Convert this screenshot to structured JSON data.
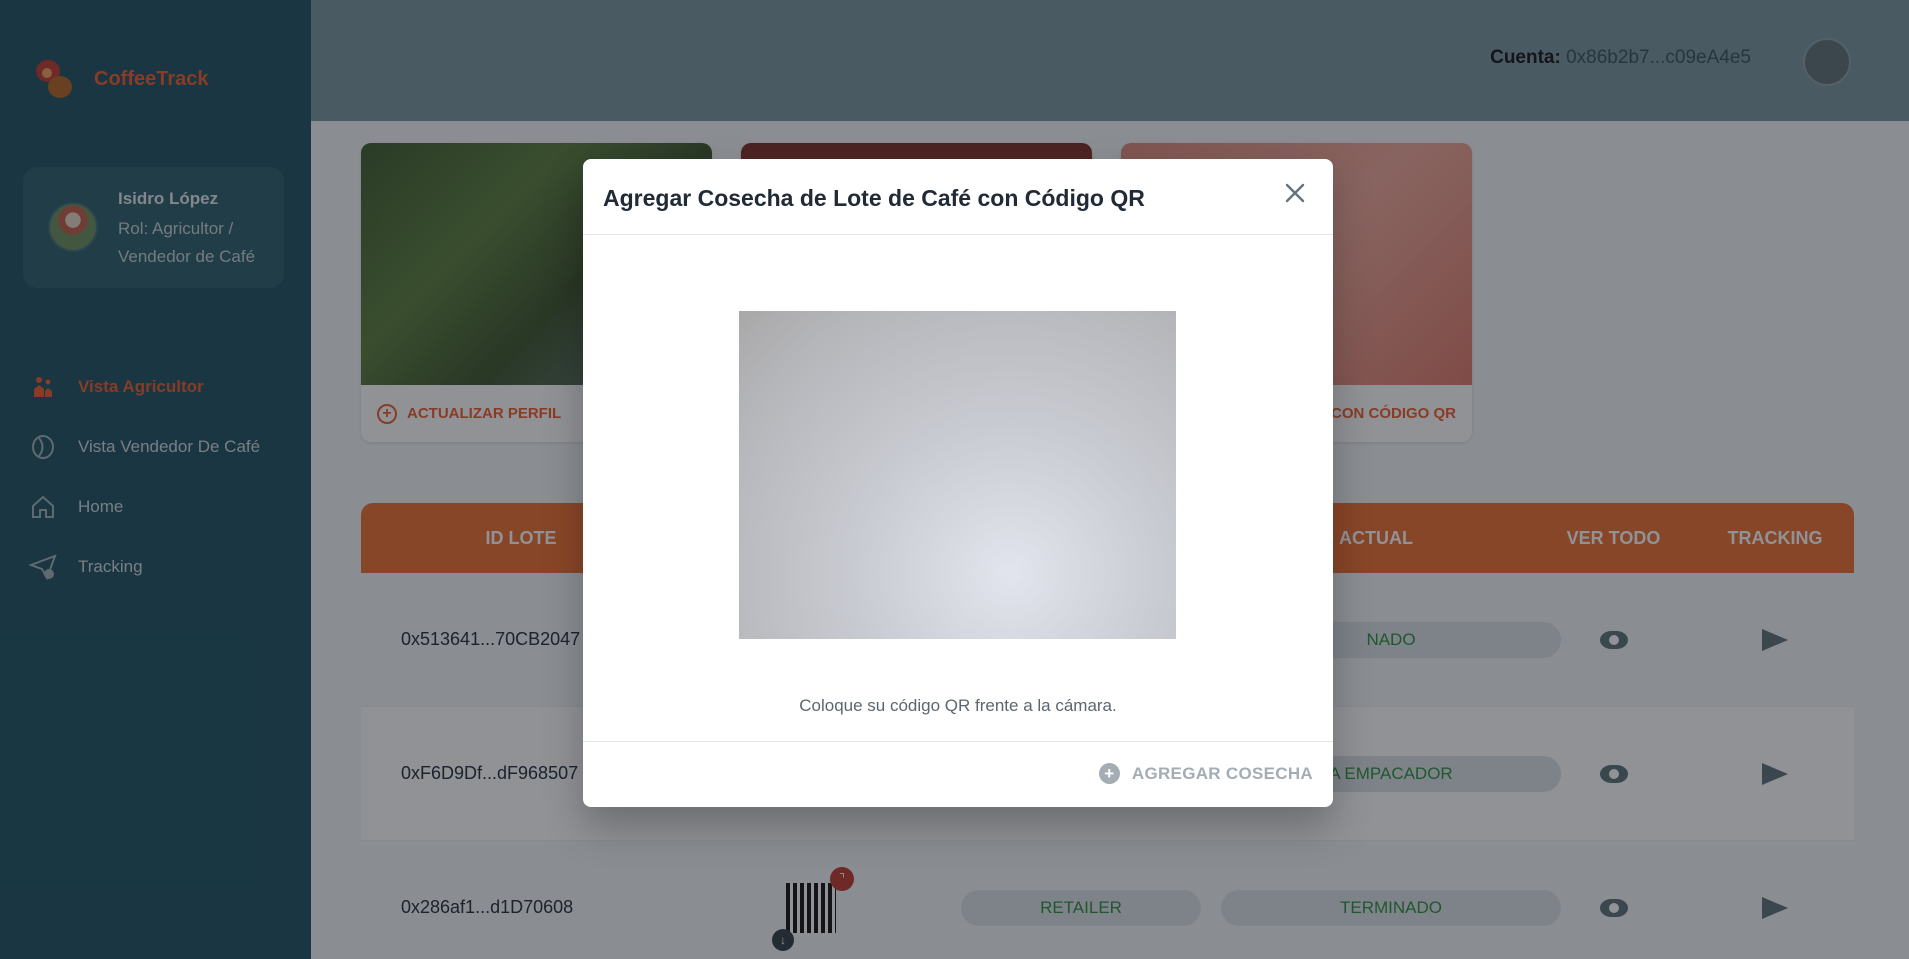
{
  "app": {
    "brand": "CoffeeTrack"
  },
  "profile": {
    "name": "Isidro López",
    "role": "Rol: Agricultor / Vendedor de Café"
  },
  "sidebar": {
    "items": [
      {
        "label": "Vista Agricultor",
        "icon": "farmer-icon",
        "active": true
      },
      {
        "label": "Vista Vendedor De Café",
        "icon": "coffee-bean-icon",
        "active": false
      },
      {
        "label": "Home",
        "icon": "home-icon",
        "active": false
      },
      {
        "label": "Tracking",
        "icon": "send-icon",
        "active": false
      }
    ]
  },
  "header": {
    "account_label": "Cuenta:",
    "account_value": "0x86b2b7...c09eA4e5"
  },
  "cards": [
    {
      "action": "ACTUALIZAR PERFIL"
    },
    {
      "action": ""
    },
    {
      "action": "CON CÓDIGO QR"
    }
  ],
  "table": {
    "columns": [
      "ID LOTE",
      "",
      "",
      "ACTUAL",
      "VER TODO",
      "TRACKING"
    ],
    "rows": [
      {
        "id": "0x513641...70CB2047",
        "role": "",
        "state": "NADO"
      },
      {
        "id": "0xF6D9Df...dF968507",
        "role": "",
        "state": "A EMPACADOR"
      },
      {
        "id": "0x286af1...d1D70608",
        "role": "RETAILER",
        "state": "TERMINADO"
      }
    ]
  },
  "modal": {
    "title": "Agregar Cosecha de Lote de Café con Código QR",
    "hint": "Coloque su código QR frente a la cámara.",
    "submit_label": "AGREGAR COSECHA"
  },
  "colors": {
    "accent": "#ef5b2a",
    "sidebar_bg": "#1c4f5e",
    "table_header": "#ef6d2d",
    "status_green": "#2a8f3b"
  }
}
